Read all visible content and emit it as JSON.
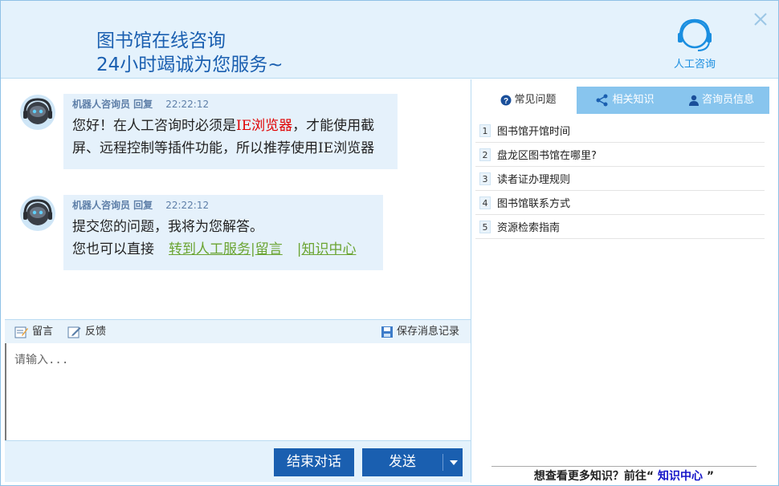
{
  "header": {
    "title": "图书馆在线咨询",
    "subtitle": "24小时竭诚为您服务~",
    "human_label": "人工咨询"
  },
  "messages": [
    {
      "sender": "机器人咨询员 回复",
      "time": "22:22:12",
      "line1_a": "您好！在人工咨询时必须是",
      "line1_red": "IE浏览器",
      "line1_b": "，才能使用截",
      "line2": "屏、远程控制等插件功能，所以推荐使用IE浏览器"
    },
    {
      "sender": "机器人咨询员 回复",
      "time": "22:22:12",
      "line1": "提交您的问题，我将为您解答。",
      "line2_prefix": "您也可以直接",
      "link_transfer": "转到人工服务",
      "link_message": "留言",
      "link_knowledge": "知识中心"
    }
  ],
  "toolbar": {
    "message": "留言",
    "feedback": "反馈",
    "save": "保存消息记录"
  },
  "input": {
    "placeholder": "请输入..."
  },
  "buttons": {
    "end": "结束对话",
    "send": "发送"
  },
  "tabs": [
    {
      "label": "常见问题",
      "icon": "question-icon",
      "active": true
    },
    {
      "label": "相关知识",
      "icon": "share-icon",
      "active": false
    },
    {
      "label": "咨询员信息",
      "icon": "user-icon",
      "active": false
    }
  ],
  "faq": [
    {
      "num": "1",
      "text": "图书馆开馆时间"
    },
    {
      "num": "2",
      "text": "盘龙区图书馆在哪里?"
    },
    {
      "num": "3",
      "text": "读者证办理规则"
    },
    {
      "num": "4",
      "text": "图书馆联系方式"
    },
    {
      "num": "5",
      "text": "资源检索指南"
    }
  ],
  "more": {
    "prefix": "想查看更多知识？前往“ ",
    "link": "知识中心",
    "suffix": " ”"
  },
  "colors": {
    "accent": "#1a5fb0",
    "header_bg": "#e4f2fc",
    "tab_bg": "#88c5ee",
    "link_green": "#6aa431",
    "highlight_red": "#e00000"
  }
}
